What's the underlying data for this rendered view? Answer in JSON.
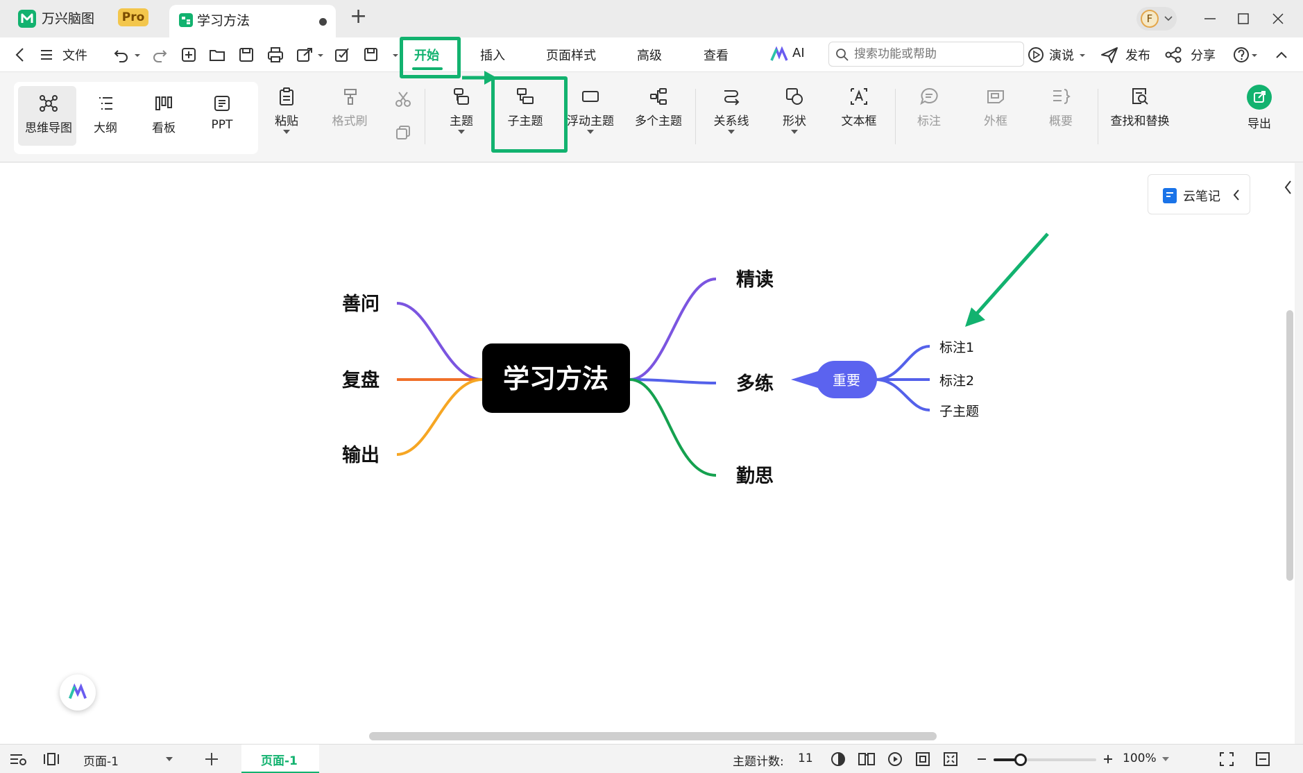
{
  "titlebar": {
    "app_name": "万兴脑图",
    "pro_badge": "Pro",
    "tab_title": "学习方法",
    "new_tab": "+"
  },
  "menubar": {
    "file": "文件",
    "tabs": [
      "开始",
      "插入",
      "页面样式",
      "高级",
      "查看"
    ],
    "ai": "AI",
    "search_placeholder": "搜索功能或帮助",
    "present": "演说",
    "publish": "发布",
    "share": "分享"
  },
  "ribbon": {
    "views": [
      "思维导图",
      "大纲",
      "看板",
      "PPT"
    ],
    "paste": "粘贴",
    "format_painter": "格式刷",
    "topic": "主题",
    "subtopic": "子主题",
    "floating_topic": "浮动主题",
    "multiple_topics": "多个主题",
    "relationship": "关系线",
    "shape": "形状",
    "textbox": "文本框",
    "callout": "标注",
    "boundary": "外框",
    "summary": "概要",
    "find_replace": "查找和替换",
    "export": "导出"
  },
  "cloud_note": "云笔记",
  "mindmap": {
    "center": "学习方法",
    "left": [
      "善问",
      "复盘",
      "输出"
    ],
    "right": [
      "精读",
      "多练",
      "勤思"
    ],
    "callout": "重要",
    "subtopics": [
      "标注1",
      "标注2",
      "子主题"
    ]
  },
  "colors": {
    "accent_green": "#12b26f",
    "branch_purple": "#7b55e0",
    "branch_orange": "#f0702a",
    "branch_yellow": "#f6a623",
    "branch_blue": "#5461ea",
    "branch_green": "#15a14f",
    "callout_blue": "#5b63ef"
  },
  "statusbar": {
    "page_select": "页面-1",
    "page_tab": "页面-1",
    "topic_count_label": "主题计数:",
    "topic_count": "11",
    "zoom": "100%"
  }
}
